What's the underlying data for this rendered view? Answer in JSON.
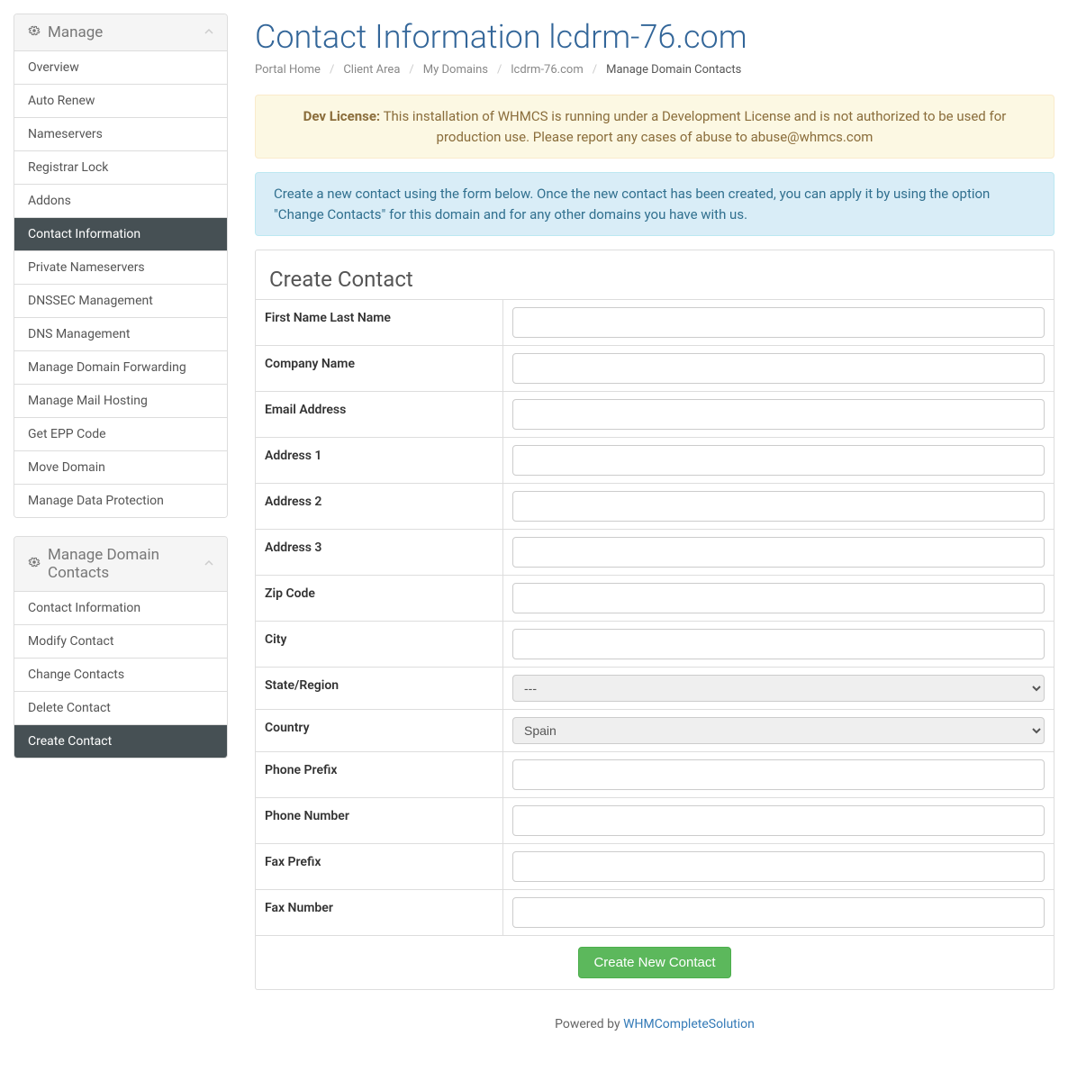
{
  "page_title": "Contact Information lcdrm-76.com",
  "breadcrumb": [
    {
      "label": "Portal Home",
      "active": false
    },
    {
      "label": "Client Area",
      "active": false
    },
    {
      "label": "My Domains",
      "active": false
    },
    {
      "label": "lcdrm-76.com",
      "active": false
    },
    {
      "label": "Manage Domain Contacts",
      "active": true
    }
  ],
  "dev_license": {
    "label": "Dev License:",
    "text": " This installation of WHMCS is running under a Development License and is not authorized to be used for production use. Please report any cases of abuse to abuse@whmcs.com"
  },
  "info_text": "Create a new contact using the form below. Once the new contact has been created, you can apply it by using the option \"Change Contacts\" for this domain and for any other domains you have with us.",
  "sidebar": {
    "manage": {
      "title": "Manage",
      "items": [
        {
          "label": "Overview",
          "active": false
        },
        {
          "label": "Auto Renew",
          "active": false
        },
        {
          "label": "Nameservers",
          "active": false
        },
        {
          "label": "Registrar Lock",
          "active": false
        },
        {
          "label": "Addons",
          "active": false
        },
        {
          "label": "Contact Information",
          "active": true
        },
        {
          "label": "Private Nameservers",
          "active": false
        },
        {
          "label": "DNSSEC Management",
          "active": false
        },
        {
          "label": "DNS Management",
          "active": false
        },
        {
          "label": "Manage Domain Forwarding",
          "active": false
        },
        {
          "label": "Manage Mail Hosting",
          "active": false
        },
        {
          "label": "Get EPP Code",
          "active": false
        },
        {
          "label": "Move Domain",
          "active": false
        },
        {
          "label": "Manage Data Protection",
          "active": false
        }
      ]
    },
    "contacts": {
      "title": "Manage Domain Contacts",
      "items": [
        {
          "label": "Contact Information",
          "active": false
        },
        {
          "label": "Modify Contact",
          "active": false
        },
        {
          "label": "Change Contacts",
          "active": false
        },
        {
          "label": "Delete Contact",
          "active": false
        },
        {
          "label": "Create Contact",
          "active": true
        }
      ]
    }
  },
  "form": {
    "heading": "Create Contact",
    "fields": [
      {
        "label": "First Name Last Name",
        "type": "text",
        "value": ""
      },
      {
        "label": "Company Name",
        "type": "text",
        "value": ""
      },
      {
        "label": "Email Address",
        "type": "text",
        "value": ""
      },
      {
        "label": "Address 1",
        "type": "text",
        "value": ""
      },
      {
        "label": "Address 2",
        "type": "text",
        "value": ""
      },
      {
        "label": "Address 3",
        "type": "text",
        "value": ""
      },
      {
        "label": "Zip Code",
        "type": "text",
        "value": ""
      },
      {
        "label": "City",
        "type": "text",
        "value": ""
      },
      {
        "label": "State/Region",
        "type": "select",
        "value": "---"
      },
      {
        "label": "Country",
        "type": "select",
        "value": "Spain"
      },
      {
        "label": "Phone Prefix",
        "type": "text",
        "value": ""
      },
      {
        "label": "Phone Number",
        "type": "text",
        "value": ""
      },
      {
        "label": "Fax Prefix",
        "type": "text",
        "value": ""
      },
      {
        "label": "Fax Number",
        "type": "text",
        "value": ""
      }
    ],
    "submit_label": "Create New Contact"
  },
  "footer": {
    "prefix": "Powered by ",
    "link": "WHMCompleteSolution"
  }
}
